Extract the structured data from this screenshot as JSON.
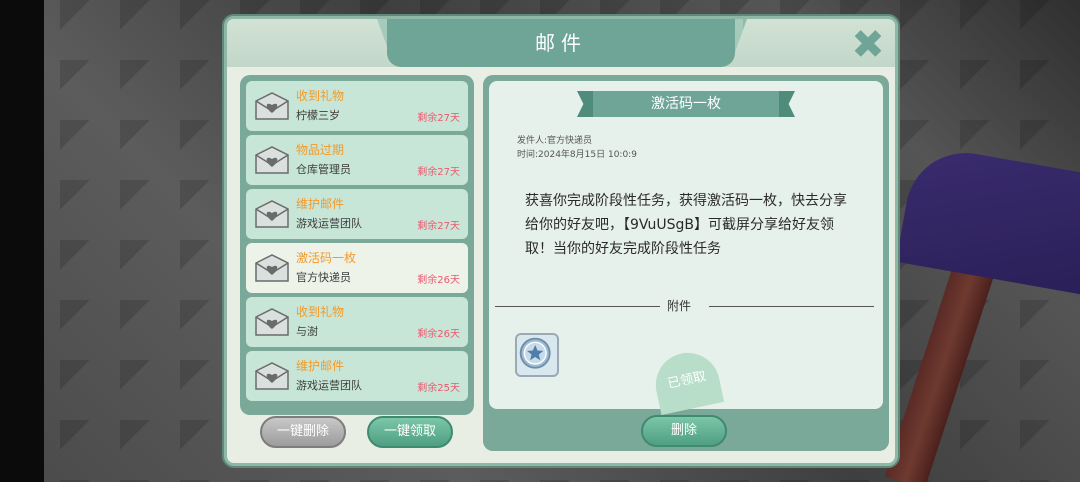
{
  "dialog": {
    "title": "邮件"
  },
  "mails": [
    {
      "title": "收到礼物",
      "sender": "柠檬三岁",
      "days": "剩余27天"
    },
    {
      "title": "物品过期",
      "sender": "仓库管理员",
      "days": "剩余27天"
    },
    {
      "title": "维护邮件",
      "sender": "游戏运营团队",
      "days": "剩余27天"
    },
    {
      "title": "激活码一枚",
      "sender": "官方快递员",
      "days": "剩余26天"
    },
    {
      "title": "收到礼物",
      "sender": "与澍",
      "days": "剩余26天"
    },
    {
      "title": "维护邮件",
      "sender": "游戏运营团队",
      "days": "剩余25天"
    }
  ],
  "buttons": {
    "delete_all": "一键删除",
    "claim_all": "一键领取",
    "delete": "删除"
  },
  "detail": {
    "title": "激活码一枚",
    "sender_line": "发件人:官方快递员",
    "time_line": "时间:2024年8月15日 10:0:9",
    "body": "获喜你完成阶段性任务，获得激活码一枚，快去分享给你的好友吧，【9VuUSgB】可截屏分享给好友领取！当你的好友完成阶段性任务",
    "attachment_label": "附件",
    "claimed_stamp": "已领取"
  },
  "colors": {
    "accent": "#6fa596",
    "mail_title": "#f19a2a",
    "days_left": "#e85a6e"
  }
}
